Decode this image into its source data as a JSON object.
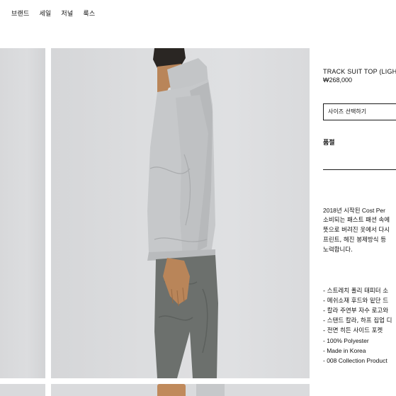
{
  "nav": {
    "items": [
      "브랜드",
      "세일",
      "저널",
      "룩스"
    ]
  },
  "product": {
    "title": "TRACK SUIT TOP (LIGH",
    "price": "₩268,000",
    "size_select": "사이즈 선택하기",
    "quality_label": "품절",
    "description": [
      "2018년 시작된 Cost Per",
      "소비되는 패스트 패션 속에",
      "뜻으로 버려진 옷에서 다시",
      "프린트, 헤진 봉제방식 등",
      "노력합니다."
    ],
    "features": [
      "- 스트레치 폴리 태피터 소",
      "- 메쉬소재 후드와 밑단 드",
      "- 칼라 주연부 자수 로고와",
      "- 스탠드 칼라, 하프 집업 디",
      "- 전면 히든 사이드 포켓",
      "- 100% Polyester",
      "- Made in Korea",
      "- 008 Collection Product"
    ]
  },
  "colors": {
    "background": "#ffffff",
    "text": "#111111",
    "photo_bg": "#dcdddf",
    "jacket": "#c5c7c9",
    "pants": "#6c706d",
    "skin": "#c08a5c"
  },
  "icons": []
}
